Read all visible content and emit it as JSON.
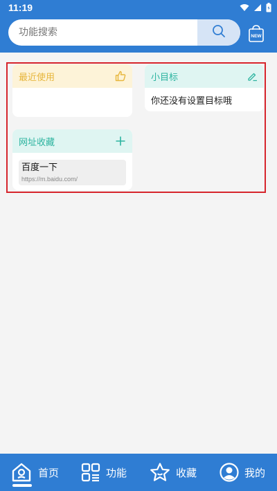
{
  "status_bar": {
    "time": "11:19",
    "icons": [
      "wifi-icon",
      "signal-icon",
      "battery-icon"
    ]
  },
  "header": {
    "search_placeholder": "功能搜索",
    "search_button_icon": "search-icon",
    "new_button_icon": "new-bag-icon",
    "new_badge_text": "NEW"
  },
  "cards": {
    "recent": {
      "title": "最近使用",
      "icon": "thumbs-up-icon"
    },
    "goal": {
      "title": "小目标",
      "icon": "edit-pencil-icon",
      "text": "你还没有设置目标哦"
    },
    "favorites": {
      "title": "网址收藏",
      "icon": "plus-icon",
      "items": [
        {
          "title": "百度一下",
          "url": "https://m.baidu.com/"
        }
      ]
    }
  },
  "bottom_nav": {
    "items": [
      {
        "label": "首页",
        "icon": "home-icon",
        "active": true
      },
      {
        "label": "功能",
        "icon": "grid-apps-icon",
        "active": false
      },
      {
        "label": "收藏",
        "icon": "star-icon",
        "active": false
      },
      {
        "label": "我的",
        "icon": "user-icon",
        "active": false
      }
    ]
  },
  "colors": {
    "primary": "#2f7dd3",
    "recent_accent": "#e7b63c",
    "goal_accent": "#2bb39f",
    "highlight": "#d6242b"
  }
}
